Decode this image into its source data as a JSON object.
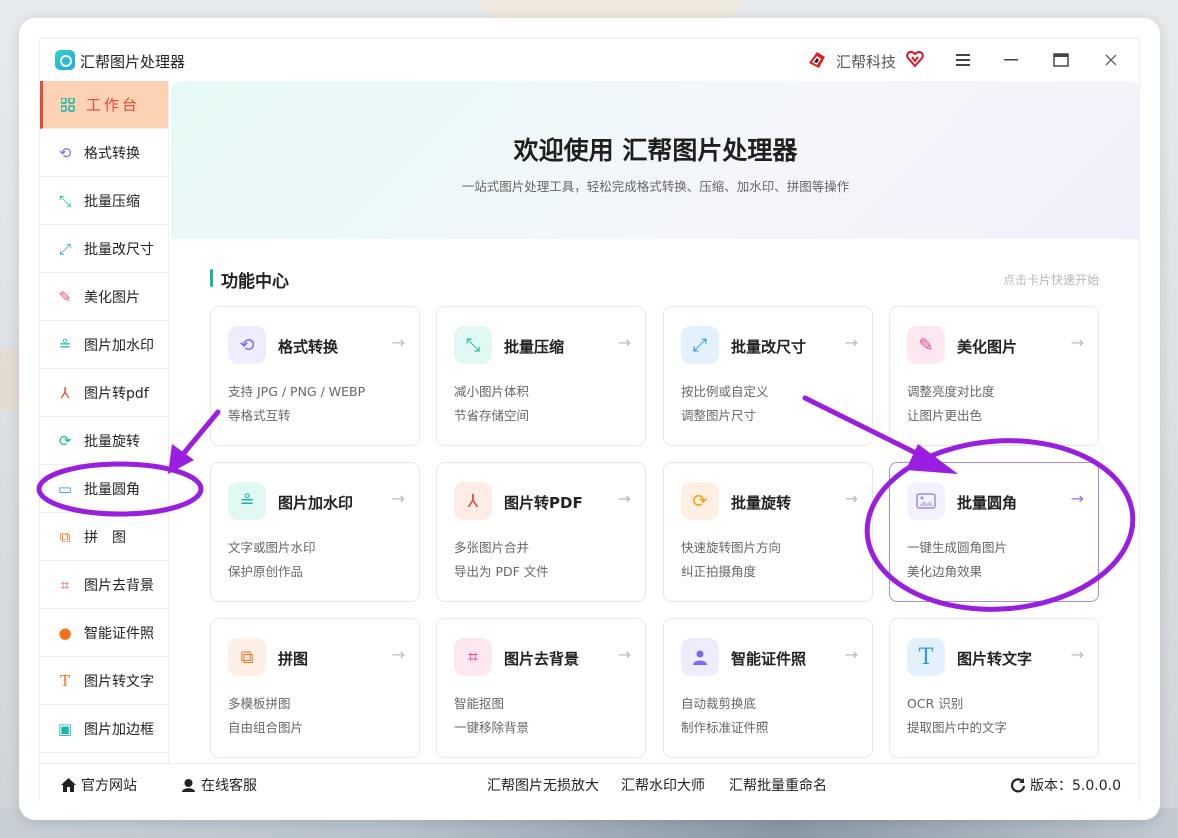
{
  "app": {
    "title": "汇帮图片处理器",
    "brand": "汇帮科技"
  },
  "colors": {
    "accent": "#14b8a6",
    "active_bg": "#fbd2b4",
    "active_text": "#e24a3b",
    "annotation": "#9a1ee0"
  },
  "sidebar": {
    "items": [
      {
        "label": "工作台",
        "icon": "grid-icon",
        "active": true
      },
      {
        "label": "格式转换",
        "icon": "convert-icon"
      },
      {
        "label": "批量压缩",
        "icon": "compress-icon"
      },
      {
        "label": "批量改尺寸",
        "icon": "resize-icon"
      },
      {
        "label": "美化图片",
        "icon": "beautify-icon"
      },
      {
        "label": "图片加水印",
        "icon": "watermark-icon"
      },
      {
        "label": "图片转pdf",
        "icon": "pdf-icon"
      },
      {
        "label": "批量旋转",
        "icon": "rotate-icon"
      },
      {
        "label": "批量圆角",
        "icon": "rounded-icon"
      },
      {
        "label": "拼　图",
        "icon": "collage-icon"
      },
      {
        "label": "图片去背景",
        "icon": "crop-icon"
      },
      {
        "label": "智能证件照",
        "icon": "person-icon"
      },
      {
        "label": "图片转文字",
        "icon": "text-icon"
      },
      {
        "label": "图片加边框",
        "icon": "border-icon"
      }
    ]
  },
  "hero": {
    "title": "欢迎使用 汇帮图片处理器",
    "subtitle": "一站式图片处理工具，轻松完成格式转换、压缩、加水印、拼图等操作"
  },
  "section": {
    "title": "功能中心",
    "hint": "点击卡片快速开始"
  },
  "cards": [
    {
      "title": "格式转换",
      "desc1": "支持 JPG / PNG / WEBP",
      "desc2": "等格式互转",
      "icon": "convert-icon"
    },
    {
      "title": "批量压缩",
      "desc1": "减小图片体积",
      "desc2": "节省存储空间",
      "icon": "compress-icon"
    },
    {
      "title": "批量改尺寸",
      "desc1": "按比例或自定义",
      "desc2": "调整图片尺寸",
      "icon": "resize-icon"
    },
    {
      "title": "美化图片",
      "desc1": "调整亮度对比度",
      "desc2": "让图片更出色",
      "icon": "beautify-icon"
    },
    {
      "title": "图片加水印",
      "desc1": "文字或图片水印",
      "desc2": "保护原创作品",
      "icon": "watermark-icon"
    },
    {
      "title": "图片转PDF",
      "desc1": "多张图片合并",
      "desc2": "导出为 PDF 文件",
      "icon": "pdf-icon"
    },
    {
      "title": "批量旋转",
      "desc1": "快速旋转图片方向",
      "desc2": "纠正拍摄角度",
      "icon": "rotate-icon"
    },
    {
      "title": "批量圆角",
      "desc1": "一键生成圆角图片",
      "desc2": "美化边角效果",
      "icon": "image-icon"
    },
    {
      "title": "拼图",
      "desc1": "多模板拼图",
      "desc2": "自由组合图片",
      "icon": "collage-icon"
    },
    {
      "title": "图片去背景",
      "desc1": "智能抠图",
      "desc2": "一键移除背景",
      "icon": "crop-icon"
    },
    {
      "title": "智能证件照",
      "desc1": "自动裁剪换底",
      "desc2": "制作标准证件照",
      "icon": "person-icon"
    },
    {
      "title": "图片转文字",
      "desc1": "OCR 识别",
      "desc2": "提取图片中的文字",
      "icon": "text-icon"
    }
  ],
  "card_arrow": "→",
  "footer": {
    "website": "官方网站",
    "support": "在线客服",
    "link1": "汇帮图片无损放大",
    "link2": "汇帮水印大师",
    "link3": "汇帮批量重命名",
    "version": "版本：5.0.0.0"
  }
}
